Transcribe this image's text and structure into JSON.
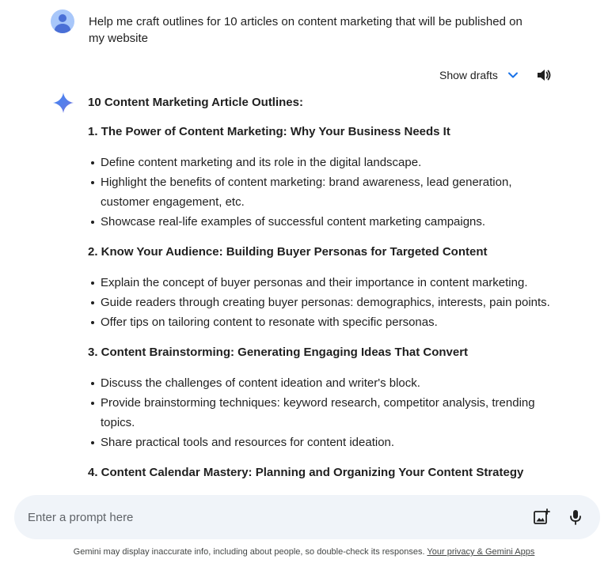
{
  "user_prompt": {
    "text": "Help me craft outlines for 10 articles on content marketing that will be published on my website"
  },
  "drafts": {
    "label": "Show drafts"
  },
  "icons": {
    "avatar": "user-avatar-icon",
    "chevron": "chevron-down-icon",
    "speaker": "speaker-icon",
    "gemini": "gemini-sparkle-icon",
    "image": "add-image-icon",
    "mic": "microphone-icon"
  },
  "colors": {
    "accent": "#1a73e8",
    "prompt_bg": "#f0f4f9",
    "avatar_bg": "#a8c7fa",
    "text": "#1f1f1f"
  },
  "response": {
    "title": "10 Content Marketing Article Outlines:",
    "sections": [
      {
        "heading": "1. The Power of Content Marketing: Why Your Business Needs It",
        "bullets": [
          "Define content marketing and its role in the digital landscape.",
          "Highlight the benefits of content marketing: brand awareness, lead generation, customer engagement, etc.",
          "Showcase real-life examples of successful content marketing campaigns."
        ]
      },
      {
        "heading": "2. Know Your Audience: Building Buyer Personas for Targeted Content",
        "bullets": [
          "Explain the concept of buyer personas and their importance in content marketing.",
          "Guide readers through creating buyer personas: demographics, interests, pain points.",
          "Offer tips on tailoring content to resonate with specific personas."
        ]
      },
      {
        "heading": "3. Content Brainstorming: Generating Engaging Ideas That Convert",
        "bullets": [
          "Discuss the challenges of content ideation and writer's block.",
          "Provide brainstorming techniques: keyword research, competitor analysis, trending topics.",
          "Share practical tools and resources for content ideation."
        ]
      },
      {
        "heading": "4. Content Calendar Mastery: Planning and Organizing Your Content Strategy",
        "bullets": []
      }
    ]
  },
  "prompt": {
    "placeholder": "Enter a prompt here"
  },
  "footer": {
    "disclaimer": "Gemini may display inaccurate info, including about people, so double-check its responses.",
    "privacy_link": "Your privacy & Gemini Apps"
  }
}
